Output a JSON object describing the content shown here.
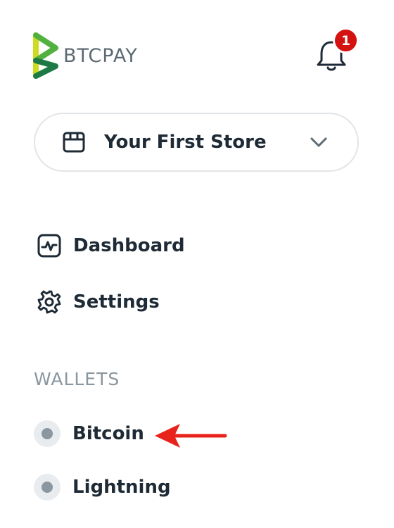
{
  "brand": {
    "name": "BTCPAY",
    "colors": {
      "green": "#51b13e",
      "dark_green": "#1e7a44",
      "lime": "#cedc21"
    }
  },
  "notifications": {
    "count": "1",
    "icon": "bell-icon",
    "badge_color": "#d4120f"
  },
  "store_selector": {
    "name": "Your First Store",
    "icon": "store-icon",
    "chevron": "chevron-down-icon"
  },
  "nav": {
    "items": [
      {
        "label": "Dashboard",
        "icon": "dashboard-icon"
      },
      {
        "label": "Settings",
        "icon": "gear-icon"
      }
    ]
  },
  "wallets": {
    "title": "WALLETS",
    "items": [
      {
        "label": "Bitcoin",
        "status": "inactive"
      },
      {
        "label": "Lightning",
        "status": "inactive"
      }
    ]
  },
  "annotation": {
    "arrow_color": "#e8231b"
  }
}
